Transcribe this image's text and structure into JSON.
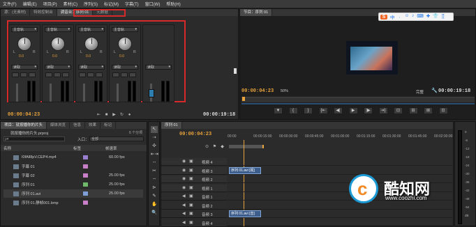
{
  "menubar": [
    "文件(F)",
    "编辑(E)",
    "项目(P)",
    "素材(C)",
    "序列(S)",
    "标记(M)",
    "字幕(T)",
    "窗口(W)",
    "帮助(H)"
  ],
  "source_panel": {
    "tabs": [
      "源：(无素材)",
      "特效控制台",
      "调音台：序列 01",
      "元数据"
    ],
    "channels": [
      {
        "label": "主音轨",
        "value": "0.0",
        "mode": "读取"
      },
      {
        "label": "主音轨",
        "value": "0.0",
        "mode": "读取"
      },
      {
        "label": "主音轨",
        "value": "0.0",
        "mode": "读取"
      },
      {
        "label": "主音轨",
        "value": "0.0",
        "mode": "读取"
      },
      {
        "label": "",
        "value": "",
        "mode": "读取"
      }
    ],
    "timecode_left": "00:00:04:23",
    "timecode_right": "00:00:19:18"
  },
  "program_panel": {
    "tab": "节目：序列 01",
    "timecode_left": "00:00:04:23",
    "zoom": "50%",
    "quality": "完整",
    "timecode_right": "00:00:19:18"
  },
  "ime_bar": {
    "brand": "S",
    "items": [
      "中",
      "ㆍ",
      "☺",
      "♪",
      "⌨",
      "✚",
      "👕",
      "⣿"
    ]
  },
  "project_panel": {
    "tabs": [
      "项目：就按播你的片头",
      "媒体浏览",
      "信息",
      "效果",
      "标记"
    ],
    "project_file": "就按播你的片头.prproj",
    "count": "6 个分项",
    "entry_label": "入口：",
    "entry_value": "全部",
    "columns": [
      "名称",
      "标签",
      "帧速率"
    ],
    "items": [
      {
        "name": "I0fAll8pV.CEP4.mp4",
        "fps": "60.00 fps",
        "color": "#9a7fd1"
      },
      {
        "name": "字幕 01",
        "fps": "",
        "color": "#c77fc8"
      },
      {
        "name": "字幕 02",
        "fps": "25.00 fps",
        "color": "#c77fc8"
      },
      {
        "name": "序列 01",
        "fps": "25.00 fps",
        "color": "#6fb86c"
      },
      {
        "name": "序列 01.avi",
        "fps": "25.00 fps",
        "color": "#7f9fd8"
      },
      {
        "name": "序列 01.静帧001.bmp",
        "fps": "",
        "color": "#c77fc8"
      }
    ]
  },
  "timeline": {
    "tab": "序列 01",
    "timecode": "00:00:04:23",
    "ruler": [
      "00:00",
      "00:00:15:00",
      "00:00:30:00",
      "00:00:45:00",
      "00:01:00:00",
      "00:01:15:00",
      "00:01:30:00",
      "00:01:45:00",
      "00:02:00:00"
    ],
    "tracks": [
      {
        "name": "视频 4",
        "clip": ""
      },
      {
        "name": "视频 3",
        "clip": "序列 01.avi [视]"
      },
      {
        "name": "视频 2",
        "clip": ""
      },
      {
        "name": "视频 1",
        "clip": ""
      },
      {
        "name": "音频 1",
        "clip": ""
      },
      {
        "name": "音频 2",
        "clip": ""
      },
      {
        "name": "音频 3",
        "clip": "序列 01.avi [音]"
      },
      {
        "name": "音频 4",
        "clip": ""
      }
    ],
    "meter_labels": [
      "0",
      "-6",
      "-12",
      "-18",
      "-24",
      "-30",
      "-36",
      "-42",
      "-48",
      "-54",
      "dB"
    ]
  },
  "watermark": {
    "title": "酷知网",
    "url": "www.coozhi.com"
  },
  "colors": {
    "accent": "#e8a33c",
    "highlight": "#d62a2a"
  }
}
